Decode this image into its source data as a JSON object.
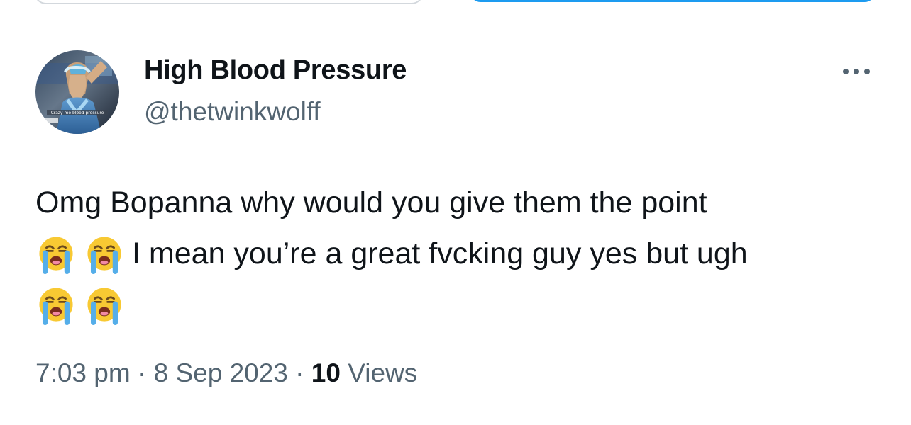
{
  "tweet": {
    "display_name": "High Blood Pressure",
    "handle": "@thetwinkwolff",
    "avatar_caption": "Crazy me blood pressure",
    "text_line1": "Omg Bopanna why would you give them the point",
    "text_line2": "I mean you’re a great fvcking guy yes but ugh",
    "emoji_name": "loudly-crying-face-icon",
    "time": "7:03 pm",
    "separator": "·",
    "date": "8 Sep 2023",
    "views_count": "10",
    "views_label": "Views"
  },
  "colors": {
    "text_primary": "#0f1419",
    "text_secondary": "#536471",
    "accent": "#1d9bf0",
    "border": "#d3d8dd"
  }
}
